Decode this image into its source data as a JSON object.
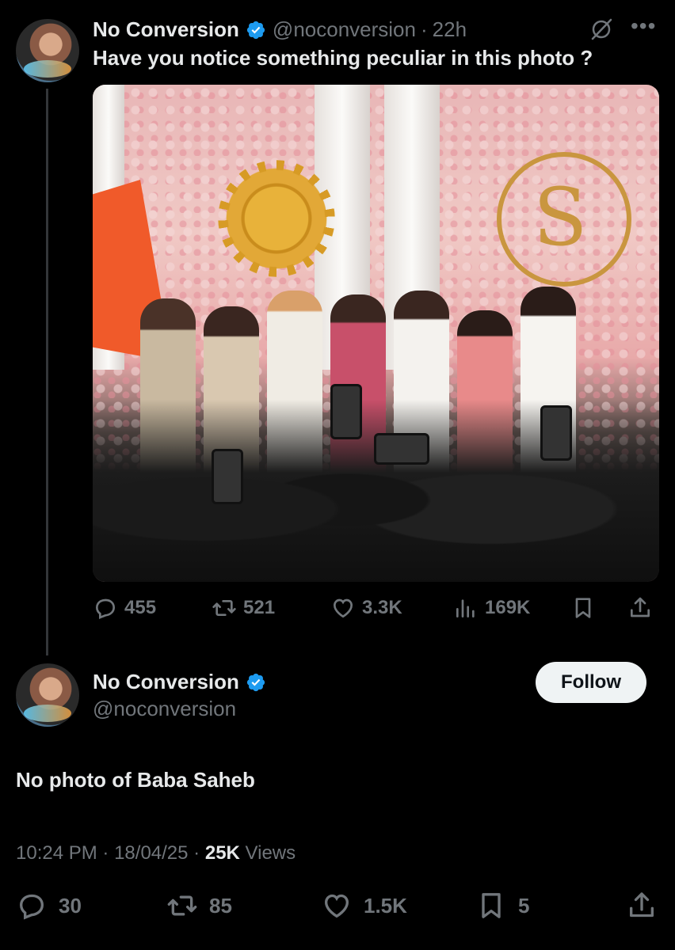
{
  "tweet": {
    "author_name": "No Conversion",
    "author_handle": "@noconversion",
    "separator": "·",
    "time_ago": "22h",
    "text": "Have you notice something peculiar in this photo ?",
    "stats": {
      "replies": "455",
      "reposts": "521",
      "likes": "3.3K",
      "views": "169K"
    }
  },
  "reply": {
    "author_name": "No Conversion",
    "author_handle": "@noconversion",
    "follow_label": "Follow",
    "text": "No photo of Baba Saheb",
    "timestamp": "10:24 PM",
    "dot": "·",
    "date": "18/04/25",
    "views_count": "25K",
    "views_label": "Views",
    "stats": {
      "replies": "30",
      "reposts": "85",
      "likes": "1.5K",
      "bookmarks": "5"
    }
  },
  "colors": {
    "background": "#000000",
    "text_primary": "#e7e9ea",
    "text_secondary": "#71767b",
    "verified_blue": "#1d9bf0",
    "follow_button_bg": "#eff3f4"
  },
  "icons": [
    "verified-badge-icon",
    "grok-icon",
    "more-icon",
    "reply-icon",
    "repost-icon",
    "like-icon",
    "views-icon",
    "bookmark-icon",
    "share-icon"
  ]
}
